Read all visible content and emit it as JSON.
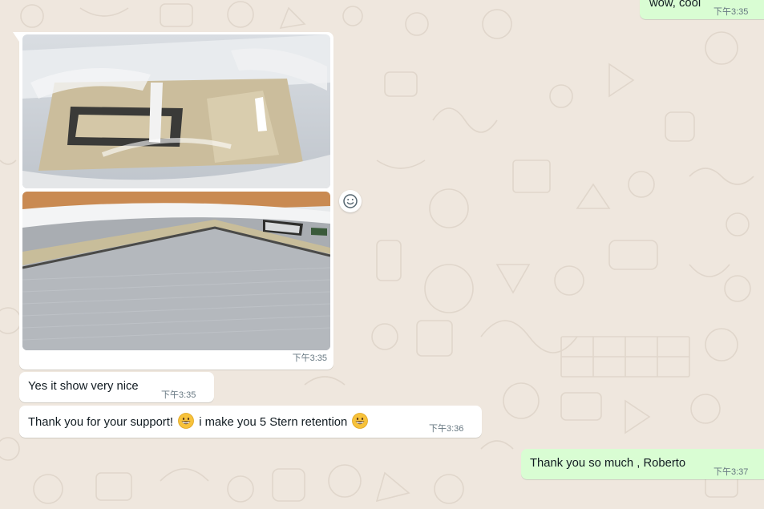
{
  "theme": {
    "wallpaper": "#efe7de",
    "incoming_bubble": "#ffffff",
    "outgoing_bubble": "#d9fdd3",
    "time_color": "#667781"
  },
  "messages": {
    "top_outgoing": {
      "text": "wow, cool",
      "time": "下午3:35"
    },
    "images": {
      "photos": [
        {
          "icon": "photo-inflatable-floor-wrapped"
        },
        {
          "icon": "photo-inflatable-floor-grey"
        }
      ],
      "time": "下午3:35",
      "react_icon": "smiley-react-icon"
    },
    "yes": {
      "text": "Yes it show very nice",
      "time": "下午3:35"
    },
    "thanks": {
      "part1": "Thank you for your support!",
      "part2": "i make you 5 Stern retention",
      "emoji": "grinning-face-emoji",
      "time": "下午3:36"
    },
    "roberto": {
      "text": "Thank you so much , Roberto",
      "time": "下午3:37"
    }
  }
}
